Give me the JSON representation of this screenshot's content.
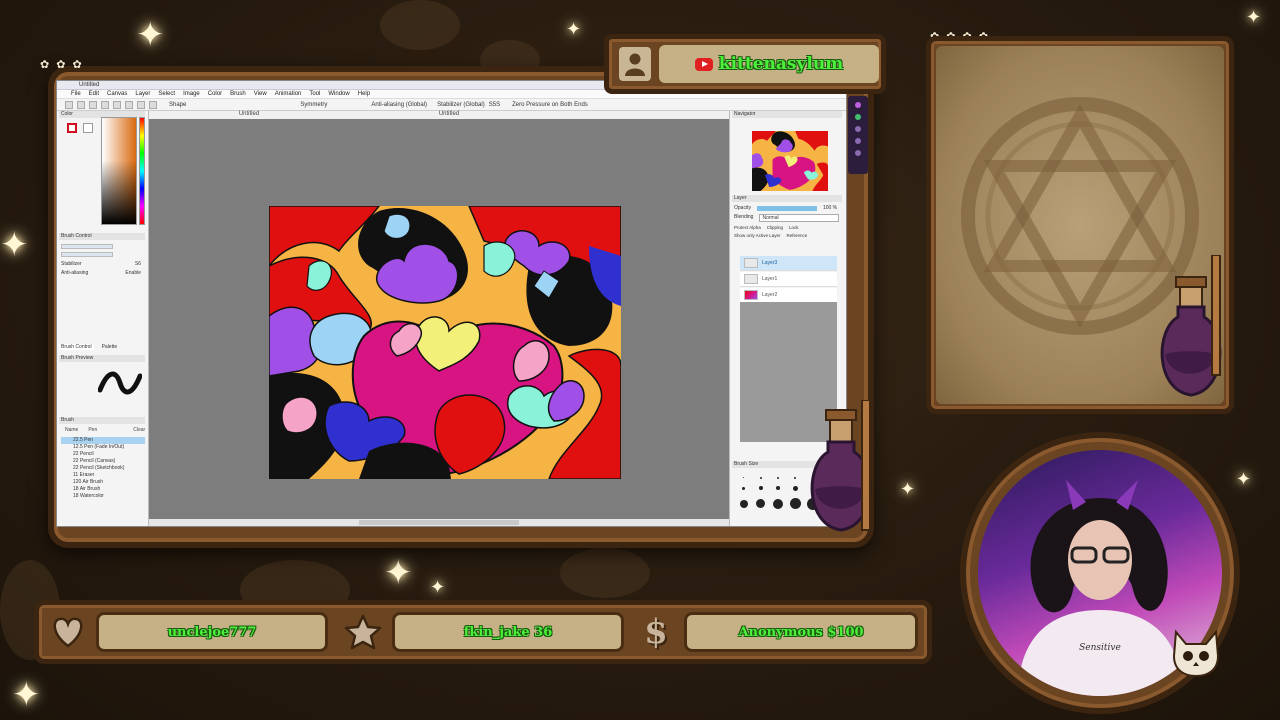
{
  "overlay": {
    "channel_name": "kittenasylum",
    "events": [
      {
        "icon": "heart-icon",
        "label": "unclejoe777"
      },
      {
        "icon": "star-icon",
        "label": "fkin_jake 36"
      },
      {
        "icon": "dollar-icon",
        "label": "Anonymous $100"
      }
    ]
  },
  "app": {
    "title": "Untitled",
    "menu": [
      "File",
      "Edit",
      "Canvas",
      "Layer",
      "Select",
      "Image",
      "Color",
      "Brush",
      "View",
      "Animation",
      "Tool",
      "Window",
      "Help"
    ],
    "tabs": [
      "Untitled",
      "Untitled"
    ],
    "toolbar": {
      "shape_label": "Shape",
      "symmetry_label": "Symmetry",
      "antialias_label": "Anti-aliasing (Global)",
      "stabilizer_label": "Stabilizer (Global)",
      "stabilizer_value": "S5S",
      "pressure_label": "Zero Pressure on Both Ends"
    },
    "left_panel": {
      "color_title": "Color",
      "brush_control_title": "Brush Control",
      "stabilizer_label": "Stabilizer",
      "stabilizer_value": "S6",
      "antialias_label": "Anti-aliasing",
      "antialias_value": "Enable",
      "tabs": [
        "Brush Control",
        "Palette"
      ],
      "brush_preview_title": "Brush Preview",
      "brush_title": "Brush",
      "brush_tabs": [
        "Name",
        "Pen",
        "Clear"
      ],
      "tools": [
        {
          "size": "22.5",
          "name": "Pen",
          "active": true
        },
        {
          "size": "12.5",
          "name": "Pen (Fade In/Out)",
          "active": false
        },
        {
          "size": "22",
          "name": "Pencil",
          "active": false
        },
        {
          "size": "22",
          "name": "Pencil (Canvas)",
          "active": false
        },
        {
          "size": "22",
          "name": "Pencil (Sketchbook)",
          "active": false
        },
        {
          "size": "11",
          "name": "Eraser",
          "active": false
        },
        {
          "size": "120",
          "name": "Air Brush",
          "active": false
        },
        {
          "size": "18",
          "name": "Air Brush",
          "active": false
        },
        {
          "size": "18",
          "name": "Watercolor",
          "active": false
        }
      ]
    },
    "right_panel": {
      "navigator_title": "Navigator",
      "layer_title": "Layer",
      "opacity_label": "Opacity",
      "opacity_value": "100 %",
      "blending_label": "Blending",
      "blending_value": "Normal",
      "protect_alpha": "Protect Alpha",
      "clipping": "Clipping",
      "lock": "Lock",
      "show_active": "Show only Active Layer",
      "reference": "Reference",
      "layers": [
        {
          "name": "Layer3",
          "active": true
        },
        {
          "name": "Layer1",
          "active": false
        },
        {
          "name": "Layer2",
          "active": false
        }
      ],
      "brush_size_title": "Brush Size"
    }
  },
  "colors": {
    "frame_wood": "#6b4422",
    "name_green": "#4cf03a",
    "pill_bg": "#c6b186",
    "active_layer": "#cfe6f8"
  }
}
